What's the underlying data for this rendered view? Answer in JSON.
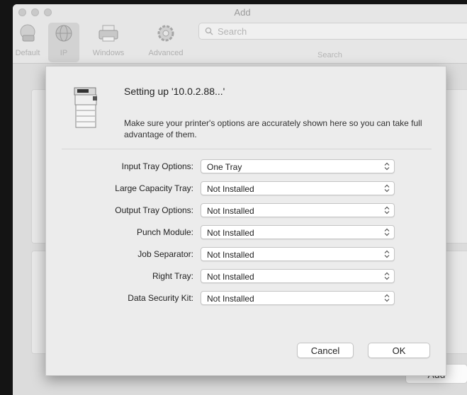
{
  "window": {
    "title": "Add"
  },
  "toolbar": {
    "tools": [
      {
        "label": "Default",
        "icon": "default-printer-icon"
      },
      {
        "label": "IP",
        "icon": "globe-icon"
      },
      {
        "label": "Windows",
        "icon": "windows-printer-icon"
      },
      {
        "label": "Advanced",
        "icon": "gear-icon"
      }
    ],
    "search_placeholder": "Search",
    "search_caption": "Search"
  },
  "background": {
    "add_button": "Add"
  },
  "sheet": {
    "heading": "Setting up '10.0.2.88...'",
    "description": "Make sure your printer's options are accurately shown here so you can take full advantage of them.",
    "options": [
      {
        "label": "Input Tray Options:",
        "value": "One Tray"
      },
      {
        "label": "Large Capacity Tray:",
        "value": "Not Installed"
      },
      {
        "label": "Output Tray Options:",
        "value": "Not Installed"
      },
      {
        "label": "Punch Module:",
        "value": "Not Installed"
      },
      {
        "label": "Job Separator:",
        "value": "Not Installed"
      },
      {
        "label": "Right Tray:",
        "value": "Not Installed"
      },
      {
        "label": "Data Security Kit:",
        "value": "Not Installed"
      }
    ],
    "cancel_label": "Cancel",
    "ok_label": "OK"
  }
}
